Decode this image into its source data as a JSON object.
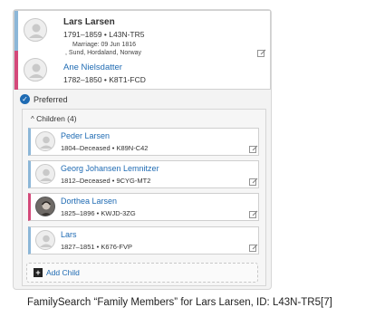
{
  "couple": {
    "father": {
      "name": "Lars Larsen",
      "lifespan": "1791–1859",
      "pid": "L43N-TR5",
      "marriage": "Marriage: 09 Jun 1816",
      "marriage_place": ", Sund, Hordaland, Norway"
    },
    "mother": {
      "name": "Ane Nielsdatter",
      "lifespan": "1782–1850",
      "pid": "K8T1-FCD"
    }
  },
  "preferred_label": "Preferred",
  "children_header": "Children (4)",
  "children": [
    {
      "name": "Peder Larsen",
      "lifespan": "1804–Deceased",
      "pid": "K89N-C42",
      "gender": "male"
    },
    {
      "name": "Georg Johansen Lemnitzer",
      "lifespan": "1812–Deceased",
      "pid": "9CYG-MT2",
      "gender": "male"
    },
    {
      "name": "Dorthea Larsen",
      "lifespan": "1825–1896",
      "pid": "KWJD-3ZG",
      "gender": "female"
    },
    {
      "name": "Lars",
      "lifespan": "1827–1851",
      "pid": "K676-FVP",
      "gender": "male"
    }
  ],
  "add_child_label": "Add Child",
  "caption": "FamilySearch “Family Members” for Lars Larsen, ID: L43N-TR5[7]",
  "colors": {
    "male_accent": "#8cb7d8",
    "female_accent": "#d4497a",
    "link": "#1f6bb3"
  },
  "icons": {
    "avatar": "person-silhouette-icon",
    "edit": "edit-icon",
    "preferred": "check-circle-icon",
    "add": "plus-icon",
    "collapse": "chevron-up-icon"
  }
}
